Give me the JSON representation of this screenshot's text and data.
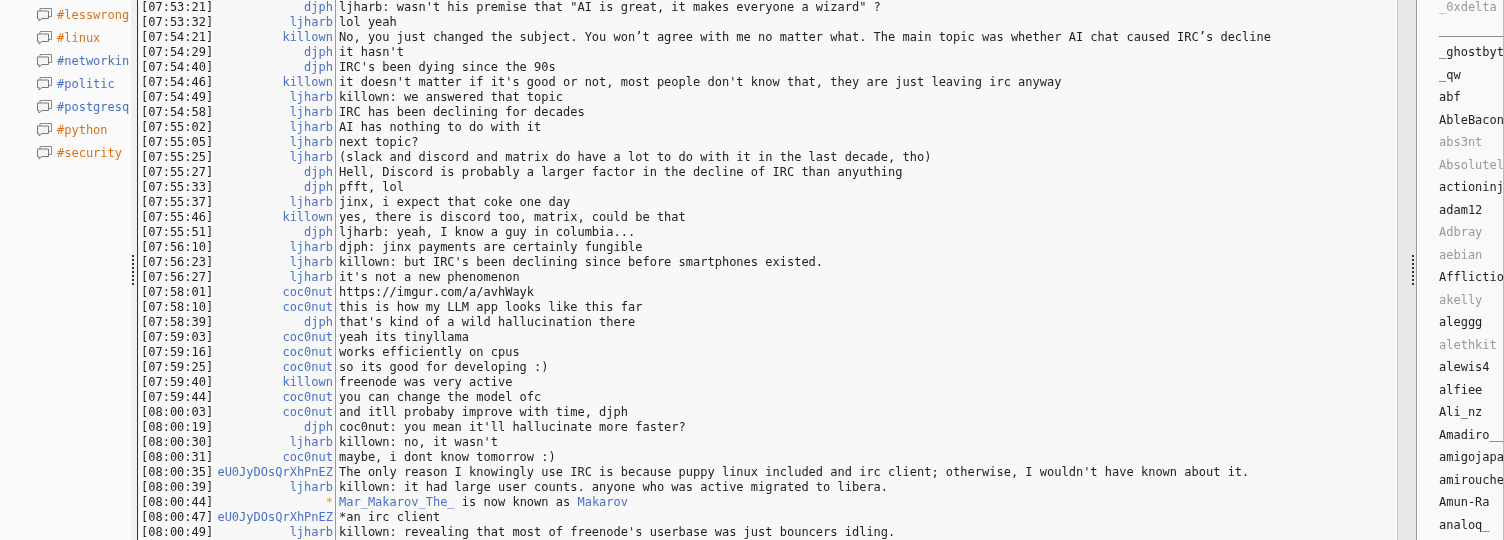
{
  "channels": [
    {
      "name": "#lesswrong",
      "color": "#d9731a"
    },
    {
      "name": "#linux",
      "color": "#d9731a"
    },
    {
      "name": "#networkin",
      "color": "#4a72c4"
    },
    {
      "name": "#politic",
      "color": "#4a72c4"
    },
    {
      "name": "#postgresq",
      "color": "#4a72c4"
    },
    {
      "name": "#python",
      "color": "#d9731a"
    },
    {
      "name": "#security",
      "color": "#d9731a"
    }
  ],
  "messages": [
    {
      "kind": "message",
      "time": "[07:53:21]",
      "nick": "djph",
      "text": "ljharb: wasn't his premise that \"AI is great, it makes everyone a wizard\" ?"
    },
    {
      "kind": "message",
      "time": "[07:53:32]",
      "nick": "ljharb",
      "text": "lol yeah"
    },
    {
      "kind": "message",
      "time": "[07:54:21]",
      "nick": "killown",
      "text": "No, you just changed the subject. You won’t agree with me no matter what. The main topic was whether AI chat caused IRC’s decline"
    },
    {
      "kind": "message",
      "time": "[07:54:29]",
      "nick": "djph",
      "text": "it hasn't"
    },
    {
      "kind": "message",
      "time": "[07:54:40]",
      "nick": "djph",
      "text": "IRC's been dying since the 90s"
    },
    {
      "kind": "message",
      "time": "[07:54:46]",
      "nick": "killown",
      "text": "it doesn't matter if it's good or not, most people don't know that, they are just leaving irc anyway"
    },
    {
      "kind": "message",
      "time": "[07:54:49]",
      "nick": "ljharb",
      "text": "killown: we answered that topic"
    },
    {
      "kind": "message",
      "time": "[07:54:58]",
      "nick": "ljharb",
      "text": "IRC has been declining for decades"
    },
    {
      "kind": "message",
      "time": "[07:55:02]",
      "nick": "ljharb",
      "text": "AI has nothing to do with it"
    },
    {
      "kind": "message",
      "time": "[07:55:05]",
      "nick": "ljharb",
      "text": "next topic?"
    },
    {
      "kind": "message",
      "time": "[07:55:25]",
      "nick": "ljharb",
      "text": "(slack and discord and matrix do have a lot to do with it in the last decade, tho)"
    },
    {
      "kind": "message",
      "time": "[07:55:27]",
      "nick": "djph",
      "text": "Hell, Discord is probably a larger factor in the decline of IRC than anyuthing"
    },
    {
      "kind": "message",
      "time": "[07:55:33]",
      "nick": "djph",
      "text": "pfft, lol"
    },
    {
      "kind": "message",
      "time": "[07:55:37]",
      "nick": "ljharb",
      "text": "jinx, i expect that coke one day"
    },
    {
      "kind": "message",
      "time": "[07:55:46]",
      "nick": "killown",
      "text": "yes, there is discord too, matrix, could be that"
    },
    {
      "kind": "message",
      "time": "[07:55:51]",
      "nick": "djph",
      "text": "ljharb: yeah, I know a guy in columbia..."
    },
    {
      "kind": "message",
      "time": "[07:56:10]",
      "nick": "ljharb",
      "text": "djph: jinx payments are certainly fungible"
    },
    {
      "kind": "message",
      "time": "[07:56:23]",
      "nick": "ljharb",
      "text": "killown: but IRC's been declining since before smartphones existed."
    },
    {
      "kind": "message",
      "time": "[07:56:27]",
      "nick": "ljharb",
      "text": "it's not a new phenomenon"
    },
    {
      "kind": "message",
      "time": "[07:58:01]",
      "nick": "coc0nut",
      "text": "https://imgur.com/a/avhWayk"
    },
    {
      "kind": "message",
      "time": "[07:58:10]",
      "nick": "coc0nut",
      "text": "this is how my LLM app looks like this far"
    },
    {
      "kind": "message",
      "time": "[07:58:39]",
      "nick": "djph",
      "text": "that's kind of a wild hallucination there"
    },
    {
      "kind": "message",
      "time": "[07:59:03]",
      "nick": "coc0nut",
      "text": "yeah its tinyllama"
    },
    {
      "kind": "message",
      "time": "[07:59:16]",
      "nick": "coc0nut",
      "text": "works efficiently on cpus"
    },
    {
      "kind": "message",
      "time": "[07:59:25]",
      "nick": "coc0nut",
      "text": "so its good for developing :)"
    },
    {
      "kind": "message",
      "time": "[07:59:40]",
      "nick": "killown",
      "text": "freenode was very active"
    },
    {
      "kind": "message",
      "time": "[07:59:44]",
      "nick": "coc0nut",
      "text": "you can change the model ofc"
    },
    {
      "kind": "message",
      "time": "[08:00:03]",
      "nick": "coc0nut",
      "text": "and itll probaby improve with time, djph"
    },
    {
      "kind": "message",
      "time": "[08:00:19]",
      "nick": "djph",
      "text": "coc0nut: you mean it'll hallucinate more faster?"
    },
    {
      "kind": "message",
      "time": "[08:00:30]",
      "nick": "ljharb",
      "text": "killown: no, it wasn't"
    },
    {
      "kind": "message",
      "time": "[08:00:31]",
      "nick": "coc0nut",
      "text": "maybe, i dont know tomorrow :)"
    },
    {
      "kind": "message",
      "time": "[08:00:35]",
      "nick": "eU0JyDOsQrXhPnEZ",
      "text": "The only reason I knowingly use IRC is because puppy linux included and irc client; otherwise, I wouldn't have known about it."
    },
    {
      "kind": "message",
      "time": "[08:00:39]",
      "nick": "ljharb",
      "text": "killown: it had large user counts. anyone who was active migrated to libera."
    },
    {
      "kind": "event",
      "time": "[08:00:44]",
      "nick": "*",
      "old_nick": "Mar_Makarov_The_",
      "text": "is now known as",
      "new_nick": "Makarov"
    },
    {
      "kind": "message",
      "time": "[08:00:47]",
      "nick": "eU0JyDOsQrXhPnEZ",
      "text": "*an irc client"
    },
    {
      "kind": "message",
      "time": "[08:00:49]",
      "nick": "ljharb",
      "text": "killown: revealing that most of freenode's userbase was just bouncers idling."
    }
  ],
  "users": [
    {
      "name": "_0xdelta",
      "away": true
    },
    {
      "name": "_________",
      "away": false
    },
    {
      "name": "_ghostbyt",
      "away": false
    },
    {
      "name": "_qw",
      "away": false
    },
    {
      "name": "abf",
      "away": false
    },
    {
      "name": "AbleBacon",
      "away": false
    },
    {
      "name": "abs3nt",
      "away": true
    },
    {
      "name": "Absolutel",
      "away": true
    },
    {
      "name": "actioninj",
      "away": false
    },
    {
      "name": "adam12",
      "away": false
    },
    {
      "name": "Adbray",
      "away": true
    },
    {
      "name": "aebian",
      "away": true
    },
    {
      "name": "Afflictio",
      "away": false
    },
    {
      "name": "akelly",
      "away": true
    },
    {
      "name": "aleggg",
      "away": false
    },
    {
      "name": "alethkit",
      "away": true
    },
    {
      "name": "alewis4",
      "away": false
    },
    {
      "name": "alfiee",
      "away": false
    },
    {
      "name": "Ali_nz",
      "away": false
    },
    {
      "name": "Amadiro__",
      "away": false
    },
    {
      "name": "amigojapa",
      "away": false
    },
    {
      "name": "amirouche",
      "away": false
    },
    {
      "name": "Amun-Ra",
      "away": false
    },
    {
      "name": "analoq_",
      "away": false
    }
  ]
}
